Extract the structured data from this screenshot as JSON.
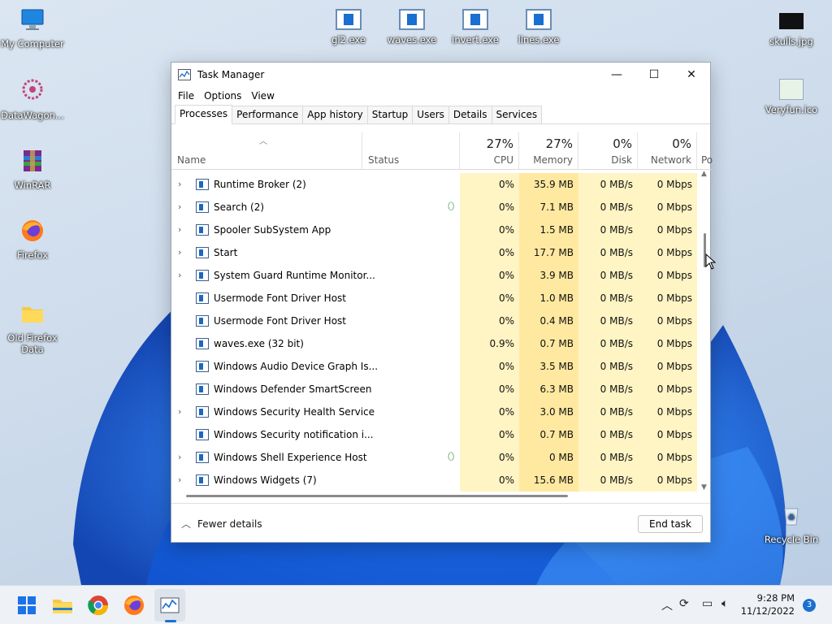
{
  "desktop": {
    "icons": [
      {
        "label": "My Computer"
      },
      {
        "label": "DataWagon..."
      },
      {
        "label": "WinRAR"
      },
      {
        "label": "Firefox"
      },
      {
        "label": "Old Firefox\nData"
      },
      {
        "label": "gl2.exe"
      },
      {
        "label": "waves.exe"
      },
      {
        "label": "invert.exe"
      },
      {
        "label": "lines.exe"
      },
      {
        "label": "skulls.jpg"
      },
      {
        "label": "Veryfun.ico"
      },
      {
        "label": "Recycle Bin"
      }
    ]
  },
  "window": {
    "title": "Task Manager",
    "controls": {
      "minimize": "—",
      "maximize": "☐",
      "close": "✕"
    },
    "menu": [
      "File",
      "Options",
      "View"
    ],
    "tabs": [
      "Processes",
      "Performance",
      "App history",
      "Startup",
      "Users",
      "Details",
      "Services"
    ],
    "active_tab": "Processes",
    "columns": {
      "name": "Name",
      "status": "Status",
      "cpu": {
        "pct": "27%",
        "label": "CPU"
      },
      "memory": {
        "pct": "27%",
        "label": "Memory"
      },
      "disk": {
        "pct": "0%",
        "label": "Disk"
      },
      "network": {
        "pct": "0%",
        "label": "Network"
      },
      "power": "Po"
    },
    "rows": [
      {
        "name": "Runtime Broker (2)",
        "expand": true,
        "status_icon": false,
        "cpu": "0%",
        "memory": "35.9 MB",
        "disk": "0 MB/s",
        "network": "0 Mbps"
      },
      {
        "name": "Search (2)",
        "expand": true,
        "status_icon": true,
        "cpu": "0%",
        "memory": "7.1 MB",
        "disk": "0 MB/s",
        "network": "0 Mbps"
      },
      {
        "name": "Spooler SubSystem App",
        "expand": true,
        "status_icon": false,
        "cpu": "0%",
        "memory": "1.5 MB",
        "disk": "0 MB/s",
        "network": "0 Mbps"
      },
      {
        "name": "Start",
        "expand": true,
        "status_icon": false,
        "cpu": "0%",
        "memory": "17.7 MB",
        "disk": "0 MB/s",
        "network": "0 Mbps"
      },
      {
        "name": "System Guard Runtime Monitor...",
        "expand": true,
        "status_icon": false,
        "cpu": "0%",
        "memory": "3.9 MB",
        "disk": "0 MB/s",
        "network": "0 Mbps"
      },
      {
        "name": "Usermode Font Driver Host",
        "expand": false,
        "status_icon": false,
        "cpu": "0%",
        "memory": "1.0 MB",
        "disk": "0 MB/s",
        "network": "0 Mbps"
      },
      {
        "name": "Usermode Font Driver Host",
        "expand": false,
        "status_icon": false,
        "cpu": "0%",
        "memory": "0.4 MB",
        "disk": "0 MB/s",
        "network": "0 Mbps"
      },
      {
        "name": "waves.exe (32 bit)",
        "expand": false,
        "status_icon": false,
        "cpu": "0.9%",
        "memory": "0.7 MB",
        "disk": "0 MB/s",
        "network": "0 Mbps"
      },
      {
        "name": "Windows Audio Device Graph Is...",
        "expand": false,
        "status_icon": false,
        "cpu": "0%",
        "memory": "3.5 MB",
        "disk": "0 MB/s",
        "network": "0 Mbps"
      },
      {
        "name": "Windows Defender SmartScreen",
        "expand": false,
        "status_icon": false,
        "cpu": "0%",
        "memory": "6.3 MB",
        "disk": "0 MB/s",
        "network": "0 Mbps"
      },
      {
        "name": "Windows Security Health Service",
        "expand": true,
        "status_icon": false,
        "cpu": "0%",
        "memory": "3.0 MB",
        "disk": "0 MB/s",
        "network": "0 Mbps"
      },
      {
        "name": "Windows Security notification i...",
        "expand": false,
        "status_icon": false,
        "cpu": "0%",
        "memory": "0.7 MB",
        "disk": "0 MB/s",
        "network": "0 Mbps"
      },
      {
        "name": "Windows Shell Experience Host",
        "expand": true,
        "status_icon": true,
        "cpu": "0%",
        "memory": "0 MB",
        "disk": "0 MB/s",
        "network": "0 Mbps"
      },
      {
        "name": "Windows Widgets (7)",
        "expand": true,
        "status_icon": false,
        "cpu": "0%",
        "memory": "15.6 MB",
        "disk": "0 MB/s",
        "network": "0 Mbps"
      }
    ],
    "footer": {
      "fewer_details": "Fewer details",
      "end_task": "End task"
    }
  },
  "taskbar": {
    "apps": [
      "start-icon",
      "file-explorer-icon",
      "chrome-icon",
      "firefox-icon",
      "task-manager-icon"
    ],
    "clock": {
      "time": "9:28 PM",
      "date": "11/12/2022"
    },
    "notifications": "3"
  },
  "colors": {
    "highlight": "#fff4c4",
    "highlight_strong": "#ffe9a0",
    "accent": "#1a6fd1"
  }
}
